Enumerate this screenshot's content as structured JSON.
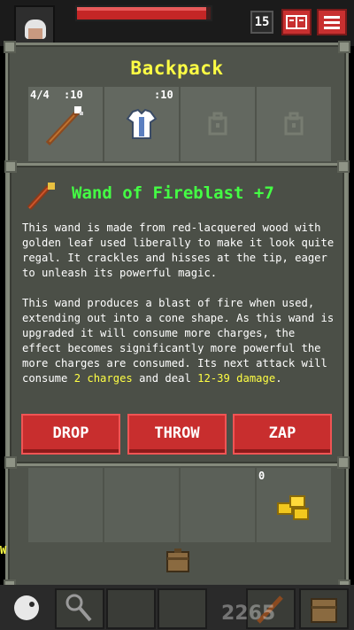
{
  "hud": {
    "depth": "15",
    "hp_fraction": 0.97
  },
  "backpack": {
    "title": "Backpack",
    "slots": [
      {
        "label_left": "4/4",
        "label_right": ":10",
        "icon": "wand-icon"
      },
      {
        "label_right": ":10",
        "icon": "cloth-armor-icon"
      },
      {
        "icon": "empty-ring-slot-icon"
      },
      {
        "icon": "empty-artifact-slot-icon"
      }
    ],
    "gold_count": "0"
  },
  "item_info": {
    "title": "Wand of Fireblast +7",
    "paragraph_1": "This wand is made from red-lacquered wood with golden leaf used liberally to make it look quite regal. It crackles and hisses at the tip, eager to unleash its powerful magic.",
    "paragraph_2_pre": "This wand produces a blast of fire when used, extending out into a cone shape. As this wand is upgraded it will consume more charges, the effect becomes significantly more powerful the more charges are consumed. Its next attack will consume ",
    "charges_highlight": "2 charges",
    "paragraph_2_mid": " and deal ",
    "damage_highlight": "12-39 damage",
    "paragraph_2_end": ".",
    "buttons": {
      "drop": "DROP",
      "throw": "THROW",
      "zap": "ZAP"
    }
  },
  "side_text": "W",
  "watermark": "2265",
  "colors": {
    "title_yellow": "#ffff44",
    "item_green": "#44ff44",
    "button_red": "#c82e2e",
    "panel_gray": "#4f534b"
  }
}
